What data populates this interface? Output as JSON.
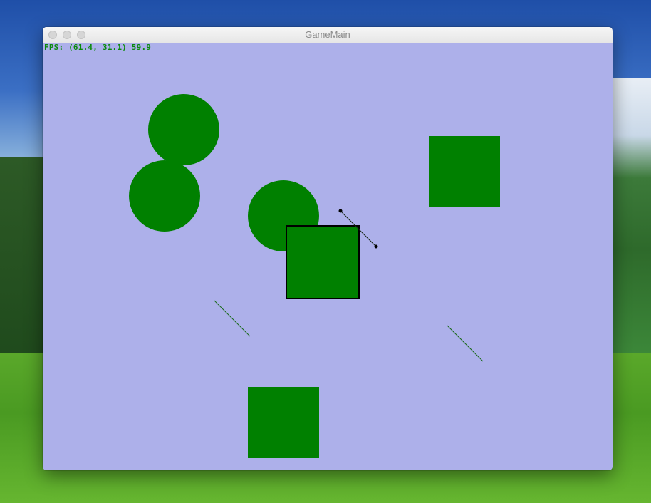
{
  "window": {
    "title": "GameMain"
  },
  "hud": {
    "fps_text": "FPS: (61.4, 31.1) 59.9"
  },
  "colors": {
    "canvas_bg": "#adb0ea",
    "shape_fill": "#008000",
    "hud_text": "#0a8a0a",
    "selection_stroke": "#000000"
  },
  "scene": {
    "shapes": [
      {
        "kind": "circle",
        "name": "ball-1"
      },
      {
        "kind": "circle",
        "name": "ball-2"
      },
      {
        "kind": "circle",
        "name": "ball-3"
      },
      {
        "kind": "square",
        "name": "box-selected",
        "selected": true
      },
      {
        "kind": "square",
        "name": "box-top-right"
      },
      {
        "kind": "square",
        "name": "box-bottom"
      },
      {
        "kind": "segment",
        "name": "segment-handle",
        "endpoints": true
      },
      {
        "kind": "segment",
        "name": "segment-left"
      },
      {
        "kind": "segment",
        "name": "segment-right"
      }
    ]
  }
}
